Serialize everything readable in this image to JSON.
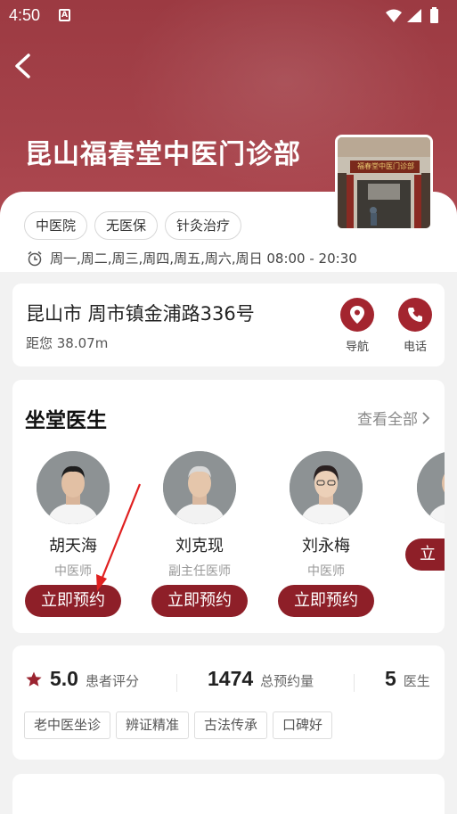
{
  "status_bar": {
    "time": "4:50",
    "notification_letter": "A"
  },
  "header": {
    "title": "昆山福春堂中医门诊部",
    "photo_sign": "福春堂中医门诊部"
  },
  "tags": [
    "中医院",
    "无医保",
    "针灸治疗"
  ],
  "hours": "周一,周二,周三,周四,周五,周六,周日 08:00 - 20:30",
  "address": {
    "main": "昆山市 周市镇金浦路336号",
    "distance": "距您 38.07m",
    "nav_label": "导航",
    "phone_label": "电话"
  },
  "doctors_section": {
    "title": "坐堂医生",
    "see_all": "查看全部",
    "doctors": [
      {
        "name": "胡天海",
        "title": "中医师",
        "button": "立即预约"
      },
      {
        "name": "刘克现",
        "title": "副主任医师",
        "button": "立即预约"
      },
      {
        "name": "刘永梅",
        "title": "中医师",
        "button": "立即预约"
      },
      {
        "name": "",
        "title": "",
        "button": "立"
      }
    ]
  },
  "stats": {
    "rating": "5.0",
    "rating_label": "患者评分",
    "appointments": "1474",
    "appointments_label": "总预约量",
    "doctors_count": "5",
    "doctors_label": "医生"
  },
  "feature_tags": [
    "老中医坐诊",
    "辨证精准",
    "古法传承",
    "口碑好"
  ],
  "colors": {
    "brand": "#8e1f28",
    "hero": "#a5424a",
    "annotation_arrow": "#e02020"
  },
  "icons": [
    "back-arrow-icon",
    "clock-icon",
    "location-pin-icon",
    "phone-icon",
    "chevron-right-icon",
    "star-icon",
    "wifi-icon",
    "signal-icon",
    "battery-icon"
  ]
}
